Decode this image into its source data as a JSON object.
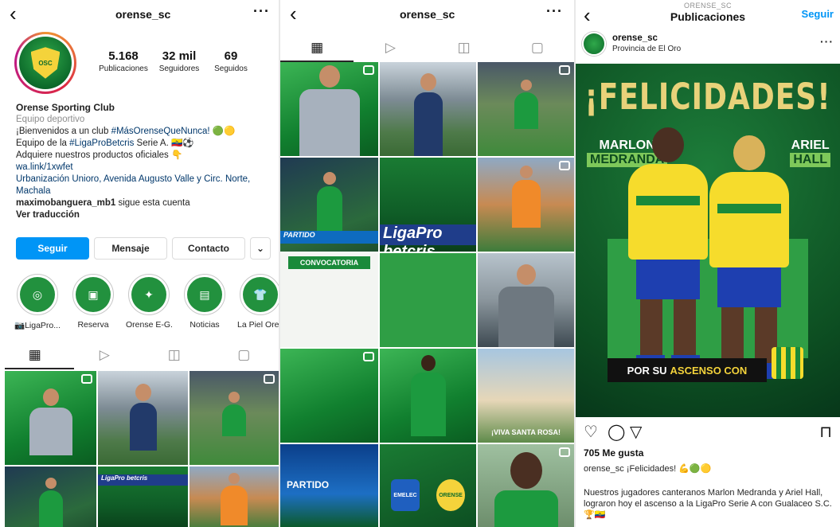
{
  "profile": {
    "username": "orense_sc",
    "stats": [
      {
        "value": "5.168",
        "label": "Publicaciones"
      },
      {
        "value": "32 mil",
        "label": "Seguidores"
      },
      {
        "value": "69",
        "label": "Seguidos"
      }
    ],
    "bio": {
      "name": "Orense Sporting Club",
      "category": "Equipo deportivo",
      "line1_prefix": "¡Bienvenidos a un club ",
      "line1_tag": "#MásOrenseQueNunca!",
      "line1_emoji": "🟢🟡",
      "line2_prefix": "Equipo de la ",
      "line2_tag": "#LigaProBetcris",
      "line2_suffix": " Serie A. 🇪🇨⚽",
      "line3": "Adquiere nuestros productos oficiales 👇",
      "link": "wa.link/1xwfet",
      "address": "Urbanización Unioro, Avenida Augusto Valle y Circ. Norte, Machala",
      "followed_by_user": "maximobanguera_mb1",
      "followed_by_suffix": " sigue esta cuenta",
      "translate": "Ver traducción"
    },
    "buttons": {
      "follow": "Seguir",
      "message": "Mensaje",
      "contact": "Contacto",
      "more": "⌄"
    },
    "highlights": [
      {
        "label": "📷LigaPro...",
        "glyph": "◎"
      },
      {
        "label": "Reserva",
        "glyph": "▣"
      },
      {
        "label": "Orense E-G...",
        "glyph": "✦"
      },
      {
        "label": "Noticias",
        "glyph": "▤"
      },
      {
        "label": "La Piel Oren...",
        "glyph": "👕"
      }
    ]
  },
  "feed": {
    "username": "orense_sc",
    "strip_text": "LigaPro betcris",
    "grid_labels": {
      "convocatoria": "CONVOCATORIA",
      "partido": "PARTIDO",
      "santa_rosa": "¡VIVA SANTA ROSA!",
      "emelec": "EMELEC",
      "orense": "ORENSE"
    }
  },
  "post": {
    "header_small": "ORENSE_SC",
    "header_big": "Publicaciones",
    "follow": "Seguir",
    "username": "orense_sc",
    "location": "Provincia de El Oro",
    "image_title": "¡FELICIDADES!",
    "left_name_1": "MARLON",
    "left_name_2": "MEDRANDA",
    "right_name_1": "ARIEL",
    "right_name_2": "HALL",
    "band_text": "POR SU",
    "band_accent": "ASCENSO CON",
    "likes": "705 Me gusta",
    "caption_user": "orense_sc",
    "caption_text": " ¡Felicidades! 💪🟢🟡",
    "caption_body": "Nuestros jugadores canteranos Marlon Medranda y Ariel Hall, lograron hoy el ascenso a la LigaPro Serie A con Gualaceo S.C. 🏆🇪🇨"
  },
  "icons": {
    "back": "‹",
    "more": "···",
    "grid": "▦",
    "reels": "▷",
    "igtv": "◫",
    "tagged": "▢",
    "heart": "♡",
    "comment": "◯",
    "share": "▽",
    "save": "⊓"
  }
}
